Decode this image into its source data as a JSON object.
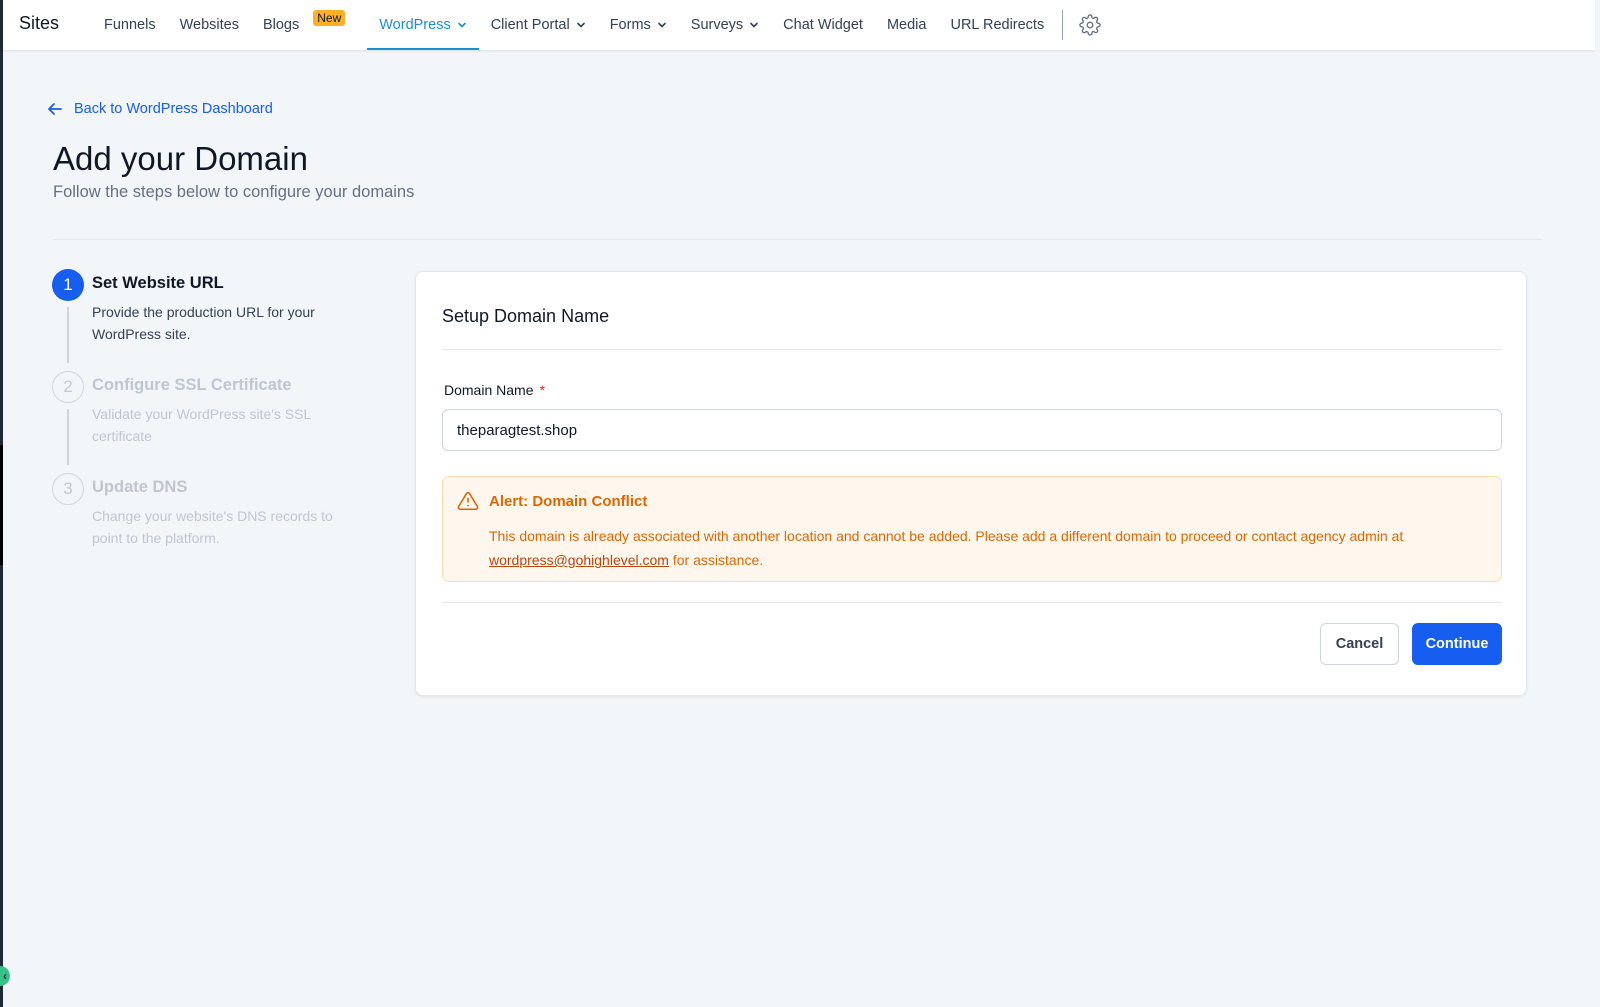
{
  "nav": {
    "brand": "Sites",
    "items": [
      {
        "label": "Funnels"
      },
      {
        "label": "Websites"
      },
      {
        "label": "Blogs",
        "badge": "New"
      },
      {
        "label": "WordPress"
      },
      {
        "label": "Client Portal"
      },
      {
        "label": "Forms"
      },
      {
        "label": "Surveys"
      },
      {
        "label": "Chat Widget"
      },
      {
        "label": "Media"
      },
      {
        "label": "URL Redirects"
      }
    ],
    "active_item": "WordPress",
    "settings_icon": "gear-icon"
  },
  "header": {
    "back_link": "Back to WordPress Dashboard",
    "title": "Add your Domain",
    "subtitle": "Follow the steps below to configure your domains"
  },
  "steps": [
    {
      "number": "1",
      "title": "Set Website URL",
      "description": "Provide the production URL for your WordPress site.",
      "state": "active"
    },
    {
      "number": "2",
      "title": "Configure SSL Certificate",
      "description": "Validate your WordPress site's SSL certificate",
      "state": "pending"
    },
    {
      "number": "3",
      "title": "Update DNS",
      "description": "Change your website's DNS records to point to the platform.",
      "state": "pending"
    }
  ],
  "card": {
    "title": "Setup Domain Name",
    "field_label": "Domain Name",
    "required_mark": "*",
    "domain_value": "theparagtest.shop",
    "alert": {
      "icon": "warning-icon",
      "title": "Alert: Domain Conflict",
      "body_pre": "This domain is already associated with another location and cannot be added. Please add a different domain to proceed or contact agency admin at ",
      "email": "wordpress@gohighlevel.com",
      "body_post": " for assistance."
    },
    "cancel_label": "Cancel",
    "continue_label": "Continue"
  },
  "colors": {
    "primary": "#155eef",
    "active_tab": "#1a8fd8",
    "alert_text": "#dc6803",
    "alert_bg": "#fff6ed",
    "badge": "#fdb022"
  }
}
